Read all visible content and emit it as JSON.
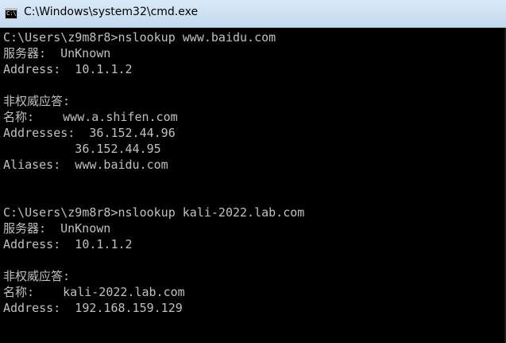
{
  "window": {
    "title": "C:\\Windows\\system32\\cmd.exe",
    "icon_label": "C:\\"
  },
  "console": {
    "lines": [
      "C:\\Users\\z9m8r8>nslookup www.baidu.com",
      "服务器:  UnKnown",
      "Address:  10.1.1.2",
      "",
      "非权威应答:",
      "名称:    www.a.shifen.com",
      "Addresses:  36.152.44.96",
      "          36.152.44.95",
      "Aliases:  www.baidu.com",
      "",
      "",
      "C:\\Users\\z9m8r8>nslookup kali-2022.lab.com",
      "服务器:  UnKnown",
      "Address:  10.1.1.2",
      "",
      "非权威应答:",
      "名称:    kali-2022.lab.com",
      "Address:  192.168.159.129"
    ]
  }
}
